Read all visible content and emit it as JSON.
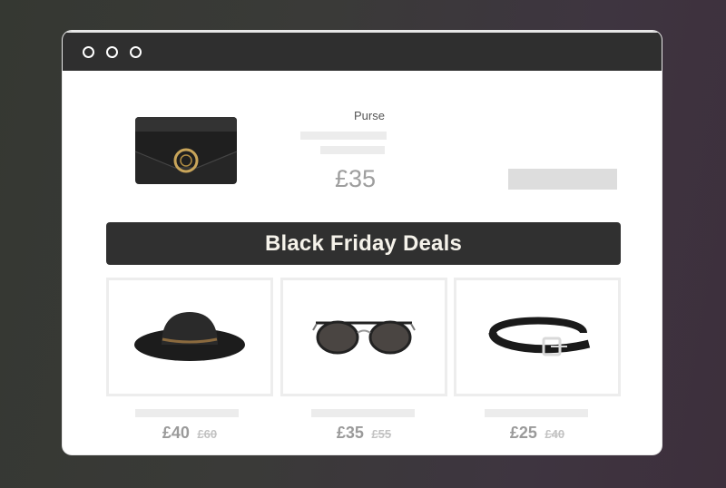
{
  "window": {
    "controls": [
      "window-dot",
      "window-dot",
      "window-dot"
    ]
  },
  "featured": {
    "name": "Purse",
    "price": "£35",
    "icon": "purse-icon"
  },
  "banner": {
    "title": "Black Friday Deals"
  },
  "deals": [
    {
      "icon": "hat-icon",
      "price": "£40",
      "old_price": "£60"
    },
    {
      "icon": "sunglasses-icon",
      "price": "£35",
      "old_price": "£55"
    },
    {
      "icon": "belt-icon",
      "price": "£25",
      "old_price": "£40"
    }
  ],
  "colors": {
    "titlebar": "#2f2f2f",
    "banner_bg": "#303030",
    "banner_text": "#f5f2ea",
    "price_text": "#9a9a9a"
  }
}
